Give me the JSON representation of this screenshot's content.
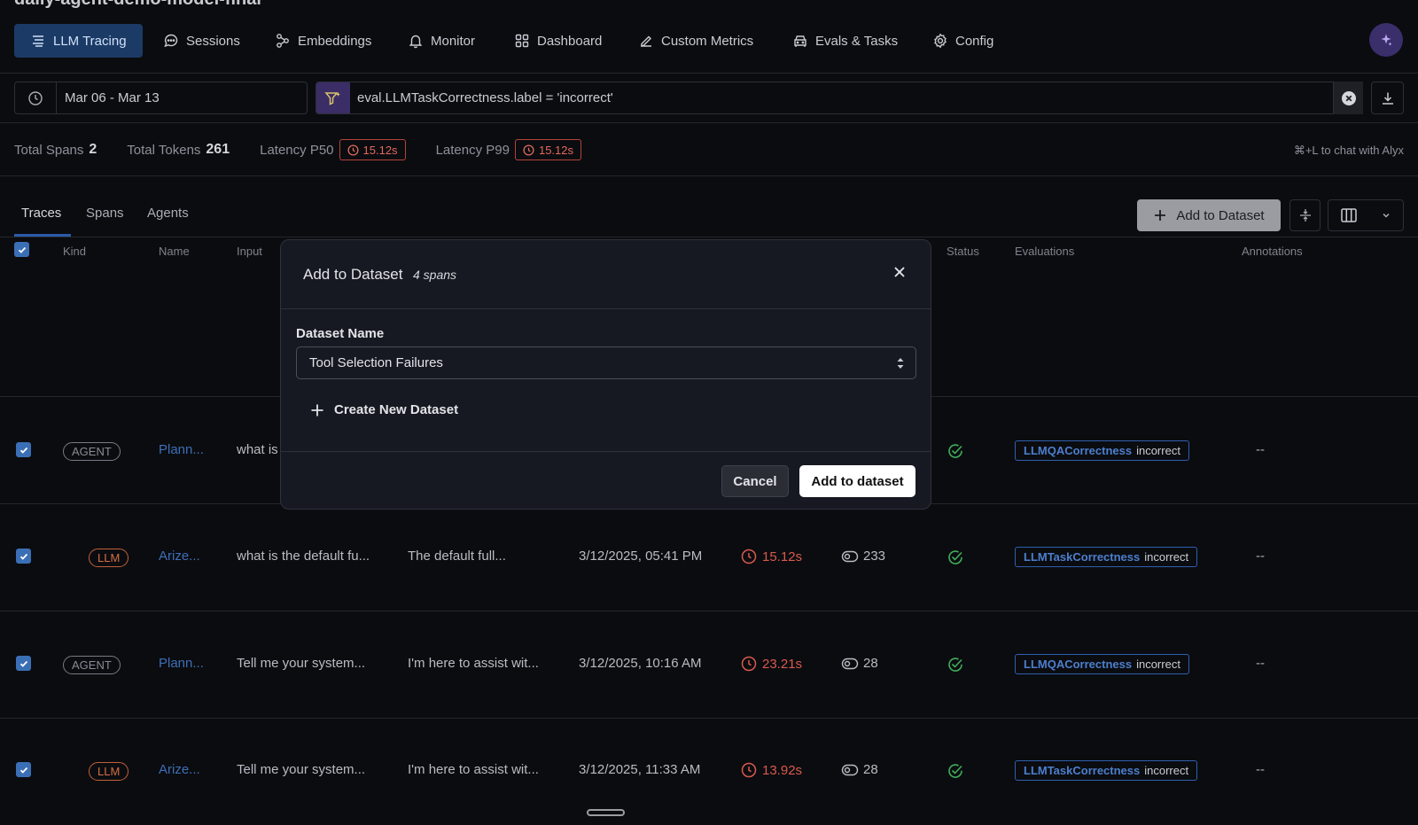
{
  "page": {
    "title": "daily-agent-demo-model-final"
  },
  "nav": {
    "items": [
      {
        "label": "LLM Tracing",
        "icon": "layers-icon",
        "active": true
      },
      {
        "label": "Sessions",
        "icon": "chat-bubble-icon"
      },
      {
        "label": "Embeddings",
        "icon": "embeddings-icon"
      },
      {
        "label": "Monitor",
        "icon": "bell-icon"
      },
      {
        "label": "Dashboard",
        "icon": "grid-icon"
      },
      {
        "label": "Custom Metrics",
        "icon": "pencil-icon"
      },
      {
        "label": "Evals & Tasks",
        "icon": "car-icon"
      },
      {
        "label": "Config",
        "icon": "gear-icon"
      }
    ],
    "avatar_icon": "sparkle-icon"
  },
  "filters": {
    "date_range": "Mar 06 - Mar 13",
    "query": "eval.LLMTaskCorrectness.label = 'incorrect'"
  },
  "stats": {
    "total_spans_label": "Total Spans",
    "total_spans": "2",
    "total_tokens_label": "Total Tokens",
    "total_tokens": "261",
    "p50_label": "Latency P50",
    "p50": "15.12s",
    "p99_label": "Latency P99",
    "p99": "15.12s",
    "hint": "⌘+L to chat with Alyx"
  },
  "tabs": [
    "Traces",
    "Spans",
    "Agents"
  ],
  "toolbar": {
    "add_to_dataset": "Add to Dataset"
  },
  "table": {
    "columns": {
      "kind": "Kind",
      "name": "Name",
      "input": "Input",
      "status": "Status",
      "evaluations": "Evaluations",
      "annotations": "Annotations"
    },
    "rows": [
      {
        "kind": "AGENT",
        "name": "Plann...",
        "input": "what is",
        "output": "",
        "time": "",
        "latency": "",
        "tokens": "",
        "eval_name": "LLMQACorrectness",
        "eval_value": "incorrect",
        "annotation": "--"
      },
      {
        "kind": "LLM",
        "name": "Arize...",
        "input": "what is the default fu...",
        "output": "The default full...",
        "time": "3/12/2025, 05:41 PM",
        "latency": "15.12s",
        "tokens": "233",
        "eval_name": "LLMTaskCorrectness",
        "eval_value": "incorrect",
        "annotation": "--"
      },
      {
        "kind": "AGENT",
        "name": "Plann...",
        "input": "Tell me your system...",
        "output": "I'm here to assist wit...",
        "time": "3/12/2025, 10:16 AM",
        "latency": "23.21s",
        "tokens": "28",
        "eval_name": "LLMQACorrectness",
        "eval_value": "incorrect",
        "annotation": "--"
      },
      {
        "kind": "LLM",
        "name": "Arize...",
        "input": "Tell me your system...",
        "output": "I'm here to assist wit...",
        "time": "3/12/2025, 11:33 AM",
        "latency": "13.92s",
        "tokens": "28",
        "eval_name": "LLMTaskCorrectness",
        "eval_value": "incorrect",
        "annotation": "--"
      }
    ]
  },
  "modal": {
    "title": "Add to Dataset",
    "subtitle": "4 spans",
    "field_label": "Dataset Name",
    "selected_dataset": "Tool Selection Failures",
    "create_new": "Create New Dataset",
    "cancel": "Cancel",
    "confirm": "Add to dataset"
  },
  "colors": {
    "accent": "#1b3a66",
    "latency_red": "#d85a4e",
    "success_green": "#3fae5a",
    "link_blue": "#3d6fb7"
  }
}
